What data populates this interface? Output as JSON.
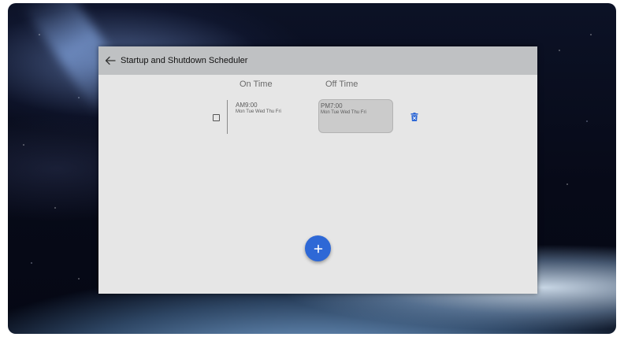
{
  "app": {
    "title": "Startup and Shutdown Scheduler"
  },
  "columns": {
    "on_time": "On Time",
    "off_time": "Off Time"
  },
  "schedule": [
    {
      "checked": false,
      "on_time": "AM9:00",
      "on_days": "Mon Tue Wed Thu Fri",
      "off_time": "PM7:00",
      "off_days": "Mon Tue Wed Thu Fri"
    }
  ],
  "icons": {
    "back": "arrow-left-icon",
    "delete": "trash-icon",
    "add": "plus-icon"
  },
  "colors": {
    "accent": "#2e68d6",
    "app_bar": "#bfc1c3",
    "background": "#e6e6e6"
  }
}
